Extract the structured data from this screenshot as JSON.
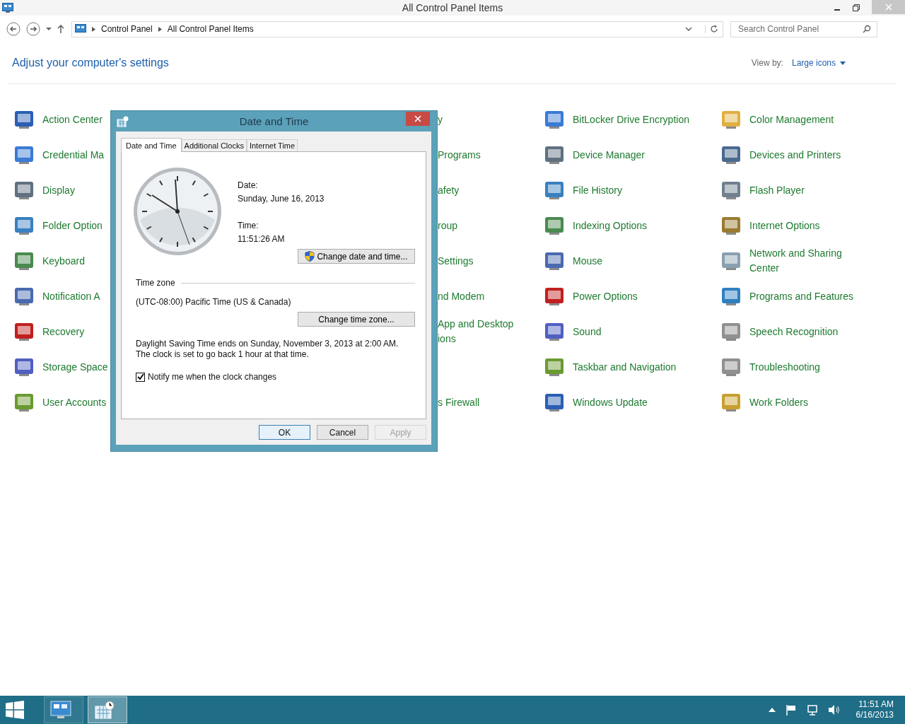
{
  "window": {
    "title": "All Control Panel Items"
  },
  "nav": {
    "breadcrumbs": [
      "Control Panel",
      "All Control Panel Items"
    ],
    "search": {
      "placeholder": "Search Control Panel"
    }
  },
  "header": {
    "title": "Adjust your computer's settings",
    "view_by_label": "View by:",
    "view_by_value": "Large icons"
  },
  "rows": [
    {
      "column_1": "Action Center",
      "column_3": "y",
      "column_4": "BitLocker Drive Encryption",
      "column_5": "Color Management"
    },
    {
      "column_1": "Credential Ma",
      "column_3": "Programs",
      "column_4": "Device Manager",
      "column_5": "Devices and Printers"
    },
    {
      "column_1": "Display",
      "column_3": "afety",
      "column_4": "File History",
      "column_5": "Flash Player"
    },
    {
      "column_1": "Folder Option",
      "column_3": "roup",
      "column_4": "Indexing Options",
      "column_5": "Internet Options"
    },
    {
      "column_1": "Keyboard",
      "column_3": "Settings",
      "column_4": "Mouse",
      "column_5": "Network and Sharing Center"
    },
    {
      "column_1": "Notification A",
      "column_3": "nd Modem",
      "column_4": "Power Options",
      "column_5": "Programs and Features"
    },
    {
      "column_1": "Recovery",
      "column_3": "App and Desktop ions",
      "column_4": "Sound",
      "column_5": "Speech Recognition"
    },
    {
      "column_1": "Storage Space",
      "column_4": "Taskbar and Navigation",
      "column_5": "Troubleshooting"
    },
    {
      "column_1": "User Accounts",
      "column_3": "s Firewall",
      "column_4": "Windows Update",
      "column_5": "Work Folders"
    }
  ],
  "dialog": {
    "title": "Date and Time",
    "tabs": [
      {
        "label": "Date and Time",
        "selected": true
      },
      {
        "label": "Additional Clocks",
        "selected": false
      },
      {
        "label": "Internet Time",
        "selected": false
      }
    ],
    "date_label": "Date:",
    "date": "Sunday, June 16, 2013",
    "time_label": "Time:",
    "time": "11:51:26 AM",
    "change_datetime_button": "Change date and time...",
    "timezone_heading": "Time zone",
    "timezone": "(UTC-08:00) Pacific Time (US & Canada)",
    "change_timezone_button": "Change time zone...",
    "dst_note": "Daylight Saving Time ends on Sunday, November 3, 2013 at 2:00 AM. The clock is set to go back 1 hour at that time.",
    "notify": {
      "label": "Notify me when the clock changes",
      "checked": true
    },
    "buttons": [
      {
        "label": "OK",
        "default": true,
        "disabled": false
      },
      {
        "label": "Cancel",
        "default": false,
        "disabled": false
      },
      {
        "label": "Apply",
        "default": false,
        "disabled": true
      }
    ]
  },
  "taskbar": {
    "apps": [
      {
        "selected": false
      },
      {
        "selected": true
      }
    ],
    "time": "11:51 AM",
    "date": "6/16/2013"
  }
}
